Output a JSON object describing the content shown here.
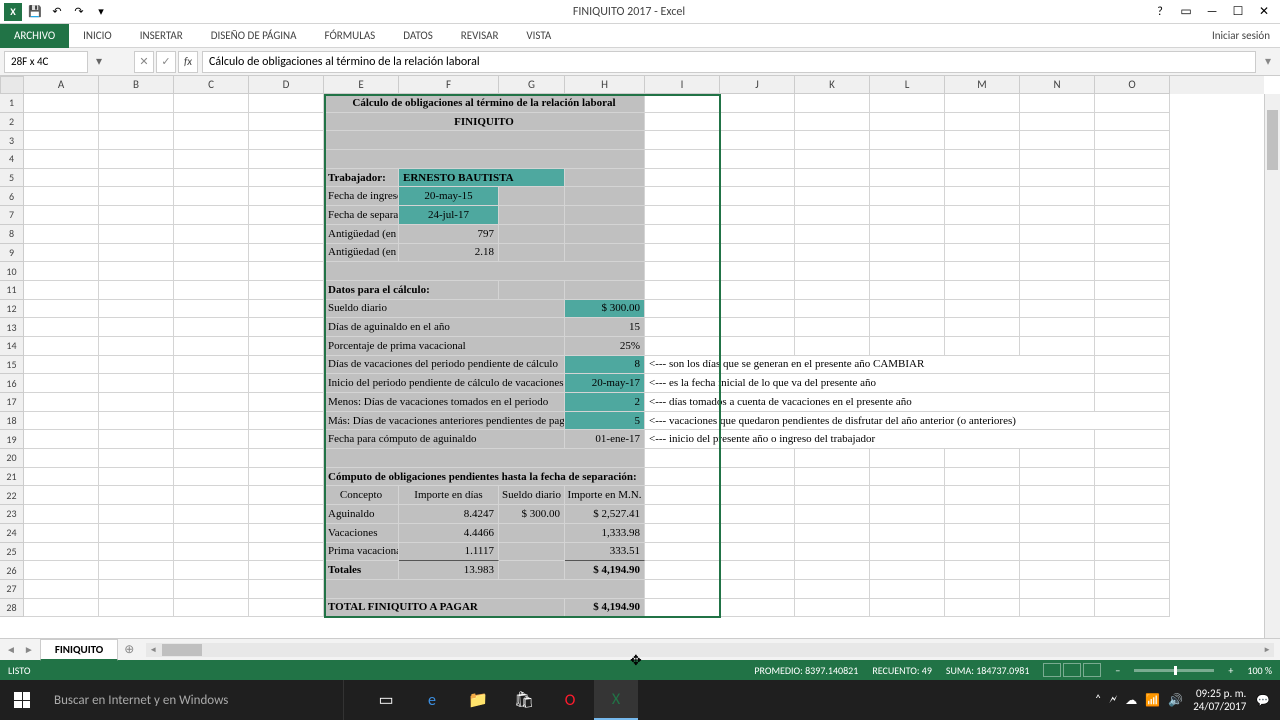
{
  "title": "FINIQUITO 2017 - Excel",
  "tabs": {
    "file": "ARCHIVO",
    "t1": "INICIO",
    "t2": "INSERTAR",
    "t3": "DISEÑO DE PÁGINA",
    "t4": "FÓRMULAS",
    "t5": "DATOS",
    "t6": "REVISAR",
    "t7": "VISTA"
  },
  "signin": "Iniciar sesión",
  "name_box": "28F x 4C",
  "formula": "Cálculo de obligaciones al término de la relación laboral",
  "columns": [
    "A",
    "B",
    "C",
    "D",
    "E",
    "F",
    "G",
    "H",
    "I",
    "J",
    "K",
    "L",
    "M",
    "N",
    "O"
  ],
  "sheet": {
    "r1_title": "Cálculo de obligaciones al término de la relación laboral",
    "r2_subtitle": "FINIQUITO",
    "r5_label": "Trabajador:",
    "r5_value": "ERNESTO BAUTISTA",
    "r6_label": "Fecha de ingreso",
    "r6_value": "20-may-15",
    "r7_label": "Fecha de separación",
    "r7_value": "24-jul-17",
    "r8_label": "Antigüedad (en días)",
    "r8_value": "797",
    "r9_label": "Antigüedad (en años)",
    "r9_value": "2.18",
    "r11_label": "Datos para el cálculo:",
    "r12_label": "Sueldo diario",
    "r12_value": "$ 300.00",
    "r13_label": "Días de aguinaldo en el año",
    "r13_value": "15",
    "r14_label": "Porcentaje de prima vacacional",
    "r14_value": "25%",
    "r15_label": "Días de vacaciones del periodo pendiente de cálculo",
    "r15_value": "8",
    "r15_note": "<--- son los días que se generan en el presente año CAMBIAR",
    "r16_label": "Inicio del periodo pendiente de cálculo de vacaciones",
    "r16_value": "20-may-17",
    "r16_note": "<--- es la fecha inicial de lo que va del presente año",
    "r17_label": "Menos: Días de vacaciones tomados en el periodo",
    "r17_value": "2",
    "r17_note": "<--- días tomados a cuenta de vacaciones en el presente año",
    "r18_label": "Más: Días de vacaciones anteriores pendientes de pago",
    "r18_value": "5",
    "r18_note": "<--- vacaciones que quedaron pendientes de disfrutar del año anterior (o anteriores)",
    "r19_label": "Fecha para cómputo de aguinaldo",
    "r19_value": "01-ene-17",
    "r19_note": "<--- inicio del presente año o ingreso del trabajador",
    "r21_label": "Cómputo de obligaciones pendientes hasta la fecha de separación:",
    "r22_c1": "Concepto",
    "r22_c2": "Importe en días",
    "r22_c3": "Sueldo diario",
    "r22_c4": "Importe en M.N.",
    "r23_c1": "Aguinaldo",
    "r23_c2": "8.4247",
    "r23_c3": "$ 300.00",
    "r23_c4": "$ 2,527.41",
    "r24_c1": "Vacaciones",
    "r24_c2": "4.4466",
    "r24_c4": "1,333.98",
    "r25_c1": "Prima vacacional",
    "r25_c2": "1.1117",
    "r25_c4": "333.51",
    "r26_c1": "Totales",
    "r26_c2": "13.983",
    "r26_c4": "$ 4,194.90",
    "r28_label": "TOTAL FINIQUITO A PAGAR",
    "r28_value": "$ 4,194.90"
  },
  "sheet_tab": "FINIQUITO",
  "status": {
    "ready": "LISTO",
    "avg": "PROMEDIO: 8397.140821",
    "count": "RECUENTO: 49",
    "sum": "SUMA: 184737.0981",
    "zoom": "100 %"
  },
  "taskbar": {
    "search": "Buscar en Internet y en Windows",
    "time": "09:25 p. m.",
    "date": "24/07/2017"
  }
}
